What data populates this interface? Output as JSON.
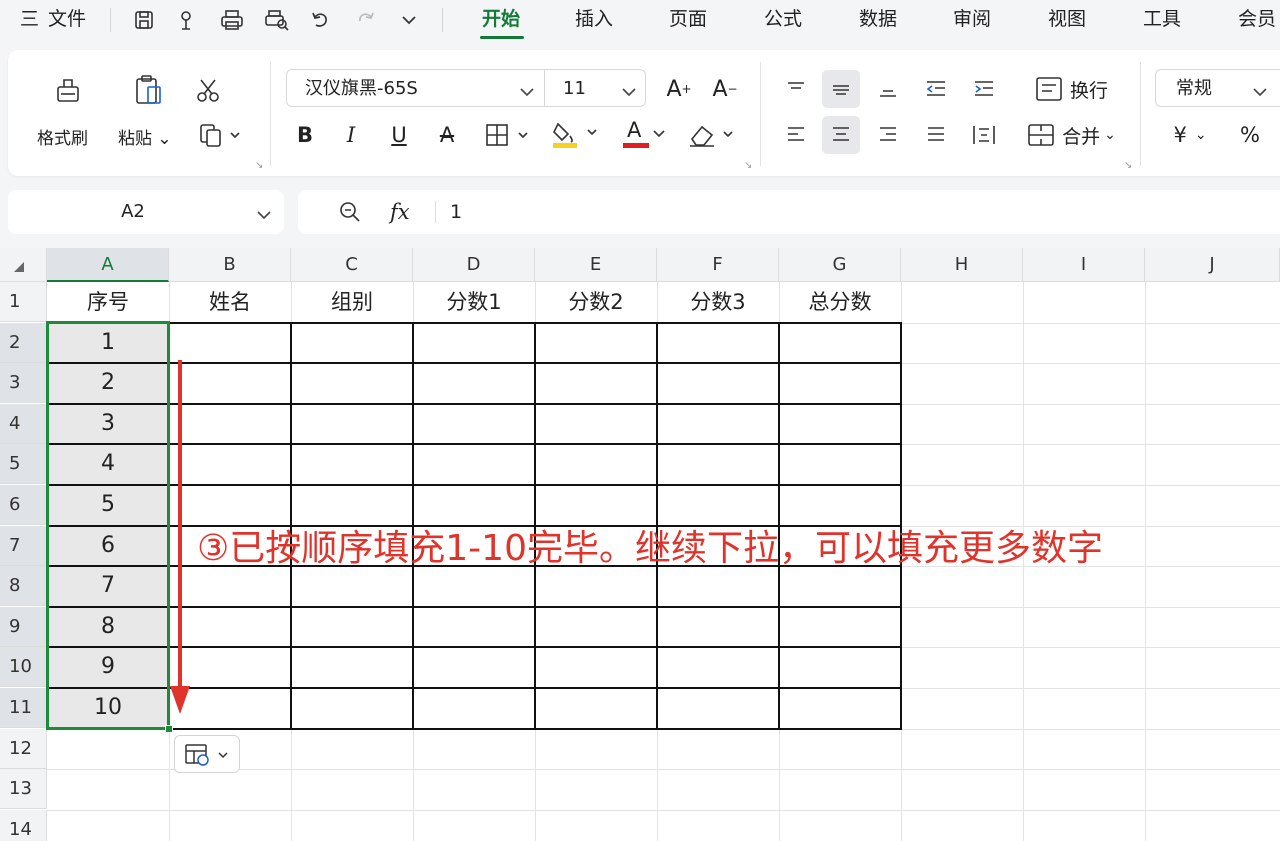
{
  "menubar": {
    "hamburger": "三",
    "file_label": "文件",
    "tabs": [
      "开始",
      "插入",
      "页面",
      "公式",
      "数据",
      "审阅",
      "视图",
      "工具",
      "会员"
    ],
    "active_tab_index": 0
  },
  "ribbon": {
    "format_painter_label": "格式刷",
    "paste_label": "粘贴",
    "font_name": "汉仪旗黑-65S",
    "font_size": "11",
    "bold": "B",
    "italic": "I",
    "underline": "U",
    "strike": "A",
    "font_color_letter": "A",
    "grow_font": "A",
    "shrink_font": "A",
    "wrap_label": "换行",
    "merge_label": "合并",
    "number_format": "常规",
    "currency": "¥",
    "percent": "%",
    "colors": {
      "highlight": "#f7d21b",
      "font_color": "#e02020",
      "accent": "#147a37"
    }
  },
  "formula_bar": {
    "name_box": "A2",
    "fx": "fx",
    "value": "1"
  },
  "grid": {
    "columns": [
      "A",
      "B",
      "C",
      "D",
      "E",
      "F",
      "G",
      "H",
      "I",
      "J"
    ],
    "rows": [
      "1",
      "2",
      "3",
      "4",
      "5",
      "6",
      "7",
      "8",
      "9",
      "10",
      "11",
      "12",
      "13",
      "14"
    ],
    "header_row": [
      "序号",
      "姓名",
      "组别",
      "分数1",
      "分数2",
      "分数3",
      "总分数"
    ],
    "column_a_values": [
      "1",
      "2",
      "3",
      "4",
      "5",
      "6",
      "7",
      "8",
      "9",
      "10"
    ],
    "selection": "A2:A11"
  },
  "annotation": {
    "text": "③已按顺序填充1-10完毕。继续下拉，可以填充更多数字",
    "color": "#e0332b"
  }
}
